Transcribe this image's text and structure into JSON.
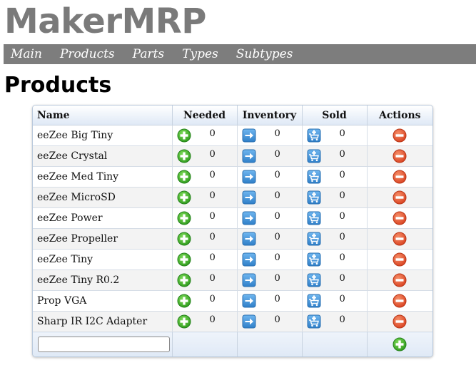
{
  "app": {
    "title": "MakerMRP"
  },
  "nav": {
    "items": [
      {
        "label": "Main"
      },
      {
        "label": "Products"
      },
      {
        "label": "Parts"
      },
      {
        "label": "Types"
      },
      {
        "label": "Subtypes"
      }
    ]
  },
  "page": {
    "title": "Products"
  },
  "table": {
    "columns": [
      "Name",
      "Needed",
      "Inventory",
      "Sold",
      "Actions"
    ],
    "rows": [
      {
        "name": "eeZee Big Tiny",
        "needed": "0",
        "inventory": "0",
        "sold": "0"
      },
      {
        "name": "eeZee Crystal",
        "needed": "0",
        "inventory": "0",
        "sold": "0"
      },
      {
        "name": "eeZee Med Tiny",
        "needed": "0",
        "inventory": "0",
        "sold": "0"
      },
      {
        "name": "eeZee MicroSD",
        "needed": "0",
        "inventory": "0",
        "sold": "0"
      },
      {
        "name": "eeZee Power",
        "needed": "0",
        "inventory": "0",
        "sold": "0"
      },
      {
        "name": "eeZee Propeller",
        "needed": "0",
        "inventory": "0",
        "sold": "0"
      },
      {
        "name": "eeZee Tiny",
        "needed": "0",
        "inventory": "0",
        "sold": "0"
      },
      {
        "name": "eeZee Tiny R0.2",
        "needed": "0",
        "inventory": "0",
        "sold": "0"
      },
      {
        "name": "Prop VGA",
        "needed": "0",
        "inventory": "0",
        "sold": "0"
      },
      {
        "name": "Sharp IR I2C Adapter",
        "needed": "0",
        "inventory": "0",
        "sold": "0"
      }
    ],
    "new_product_value": "",
    "icons": {
      "needed": "plus-circle-icon",
      "inventory": "arrow-right-icon",
      "sold": "cart-add-icon",
      "delete": "minus-circle-icon",
      "add": "plus-circle-icon"
    }
  },
  "colors": {
    "title_gray": "#7a7a7a",
    "nav_bg": "#7d7d7d",
    "add_green": "#3fae2a",
    "arrow_blue": "#3b8fd6",
    "delete_red": "#e2502b",
    "header_gradient_bottom": "#dfe9f6"
  }
}
